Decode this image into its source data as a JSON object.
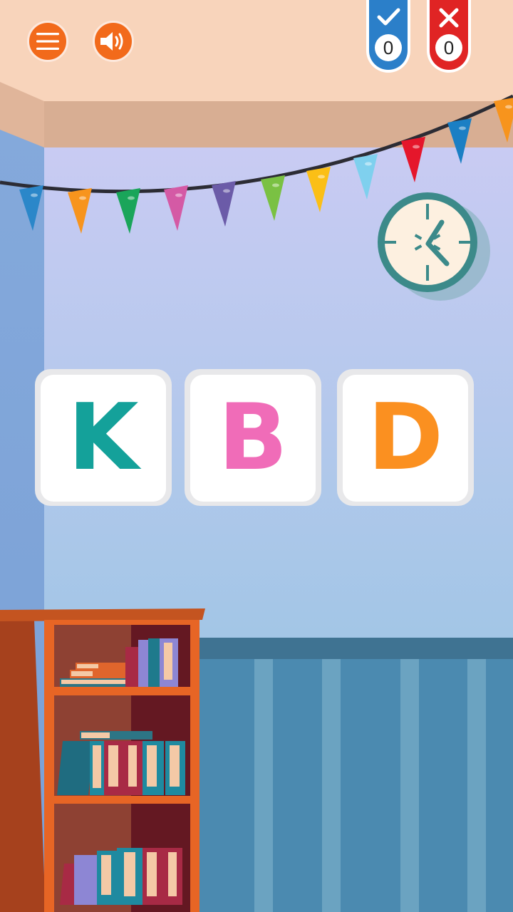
{
  "toolbar": {
    "menu_icon": "hamburger-menu-icon",
    "sound_icon": "speaker-volume-icon",
    "accent_color": "#f26a1b"
  },
  "score": {
    "correct": {
      "icon": "checkmark-icon",
      "count": "0",
      "color": "#2b7fc9"
    },
    "wrong": {
      "icon": "cross-icon",
      "count": "0",
      "color": "#e02424"
    }
  },
  "tiles": [
    {
      "letter": "K",
      "color": "#14a19a"
    },
    {
      "letter": "B",
      "color": "#f06cb8"
    },
    {
      "letter": "D",
      "color": "#fb9020"
    }
  ],
  "scene": {
    "wall_clock_icon": "wall-clock-icon",
    "bunting_colors": [
      "#2b87c9",
      "#f7941d",
      "#1aa55a",
      "#d45aa5",
      "#6b5ba8",
      "#7ac143",
      "#fbbf16",
      "#7fd0ee",
      "#e5162b",
      "#1b7fc4",
      "#f7941d"
    ]
  }
}
